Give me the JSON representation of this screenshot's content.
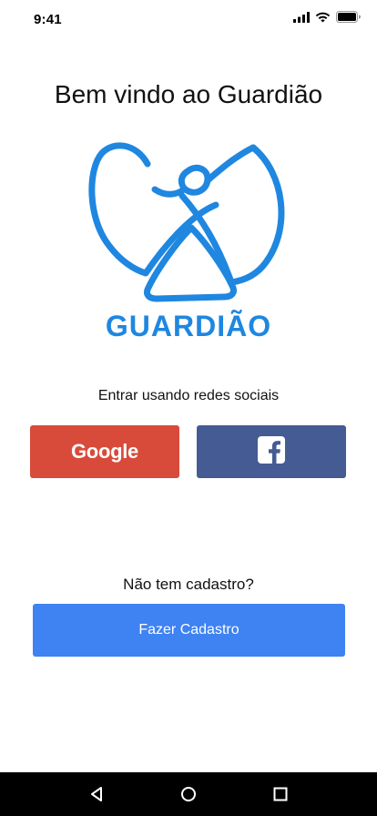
{
  "status_bar": {
    "time": "9:41",
    "icons": [
      "cellular-signal-icon",
      "wifi-icon",
      "battery-icon"
    ]
  },
  "welcome": {
    "title": "Bem vindo ao Guardião"
  },
  "logo": {
    "icon": "guardiao-logo-icon",
    "wordmark": "GUARDIÃO",
    "color": "#1f87e0"
  },
  "social": {
    "label": "Entrar usando redes sociais",
    "google": {
      "label": "Google",
      "color": "#d84b3a"
    },
    "facebook": {
      "icon": "facebook-icon",
      "color": "#445b93"
    }
  },
  "signup": {
    "prompt": "Não tem cadastro?",
    "button_label": "Fazer Cadastro",
    "color": "#3f82f2"
  },
  "nav_bar": {
    "items": [
      "back-icon",
      "home-icon",
      "recents-icon"
    ]
  }
}
